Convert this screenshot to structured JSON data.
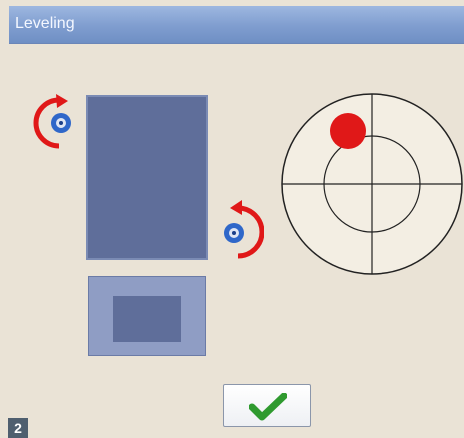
{
  "window": {
    "title": "Leveling"
  },
  "photo_label": "2",
  "icons": {
    "rotate_left": "rotate-ccw-icon",
    "rotate_right": "rotate-cw-icon",
    "confirm": "checkmark-icon"
  },
  "colors": {
    "titlebar": "#7f9dcf",
    "bubble": "#e01818",
    "rotate_arrow": "#e01818",
    "rotate_knob": "#2f67c9",
    "level_bar": "#5f6e9a",
    "checkmark": "#2f9a2f"
  }
}
